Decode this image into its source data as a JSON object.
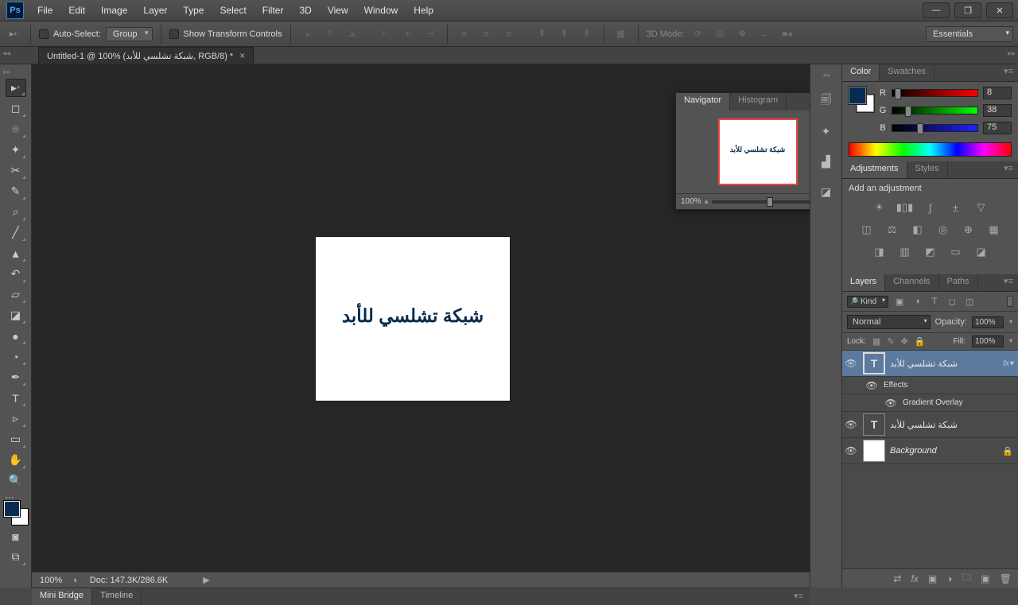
{
  "menus": [
    "File",
    "Edit",
    "Image",
    "Layer",
    "Type",
    "Select",
    "Filter",
    "3D",
    "View",
    "Window",
    "Help"
  ],
  "options": {
    "auto_select": "Auto-Select:",
    "group": "Group",
    "show_transform": "Show Transform Controls",
    "mode3d": "3D Mode:",
    "workspace": "Essentials"
  },
  "doc_tab": "Untitled-1 @ 100% (شبكة تشلسي للأبد, RGB/8) *",
  "canvas_text": "شبكة تشلسي للأبد",
  "navigator": {
    "tabs": [
      "Navigator",
      "Histogram"
    ],
    "zoom": "100%"
  },
  "color": {
    "tabs": [
      "Color",
      "Swatches"
    ],
    "r_label": "R",
    "g_label": "G",
    "b_label": "B",
    "r": "8",
    "g": "38",
    "b": "75"
  },
  "adjustments": {
    "tabs": [
      "Adjustments",
      "Styles"
    ],
    "title": "Add an adjustment"
  },
  "layers": {
    "tabs": [
      "Layers",
      "Channels",
      "Paths"
    ],
    "kind": "Kind",
    "blend": "Normal",
    "opacity_label": "Opacity:",
    "opacity": "100%",
    "lock_label": "Lock:",
    "fill_label": "Fill:",
    "fill": "100%",
    "layer1_name": "شبكة تشلسي للأبد",
    "effects": "Effects",
    "gradient": "Gradient Overlay",
    "layer2_name": "شبكة تشلسي للأبد",
    "background": "Background"
  },
  "status": {
    "zoom": "100%",
    "doc": "Doc: 147.3K/286.6K"
  },
  "bottom_tabs": [
    "Mini Bridge",
    "Timeline"
  ]
}
